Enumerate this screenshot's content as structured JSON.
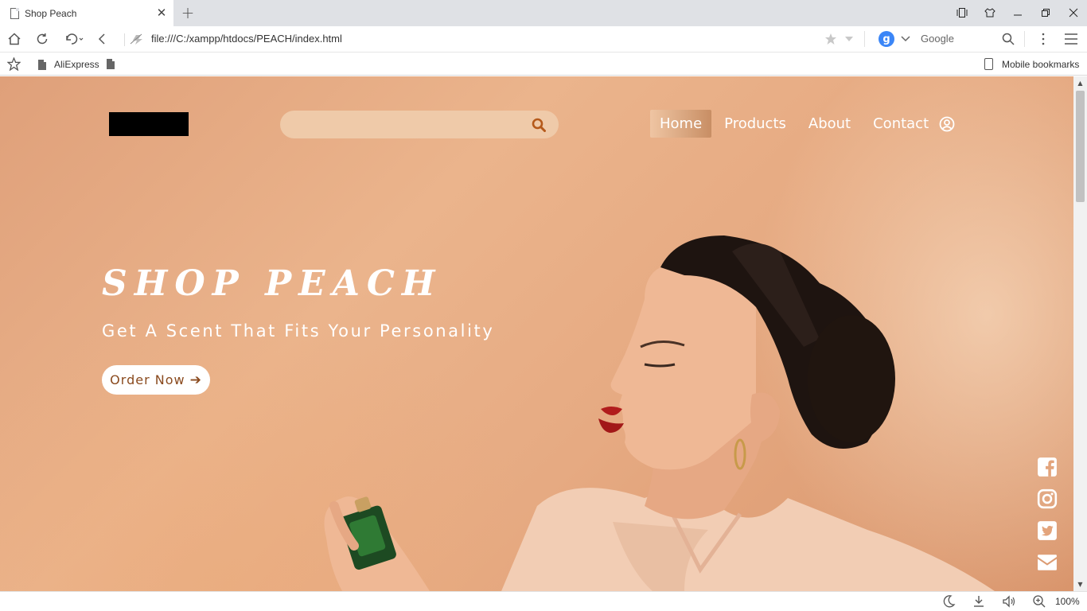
{
  "browser": {
    "tab_title": "Shop Peach",
    "address": "file:///C:/xampp/htdocs/PEACH/index.html",
    "search_engine_letter": "g",
    "search_engine_name": "Google",
    "bookmarks": [
      "AliExpress",
      ""
    ],
    "mobile_bookmarks": "Mobile bookmarks",
    "zoom": "100%"
  },
  "site": {
    "search_placeholder": "",
    "nav": [
      "Home",
      "Products",
      "About",
      "Contact"
    ],
    "active_nav": "Home",
    "hero_title": "Shop Peach",
    "hero_subtitle": "Get A Scent That Fits Your Personality",
    "cta_label": "Order Now",
    "social_icons": [
      "facebook-icon",
      "instagram-icon",
      "twitter-icon",
      "mail-icon"
    ]
  },
  "colors": {
    "background": "#e6aa82",
    "accent": "#b5591a",
    "search_bg": "#efcaa9"
  }
}
